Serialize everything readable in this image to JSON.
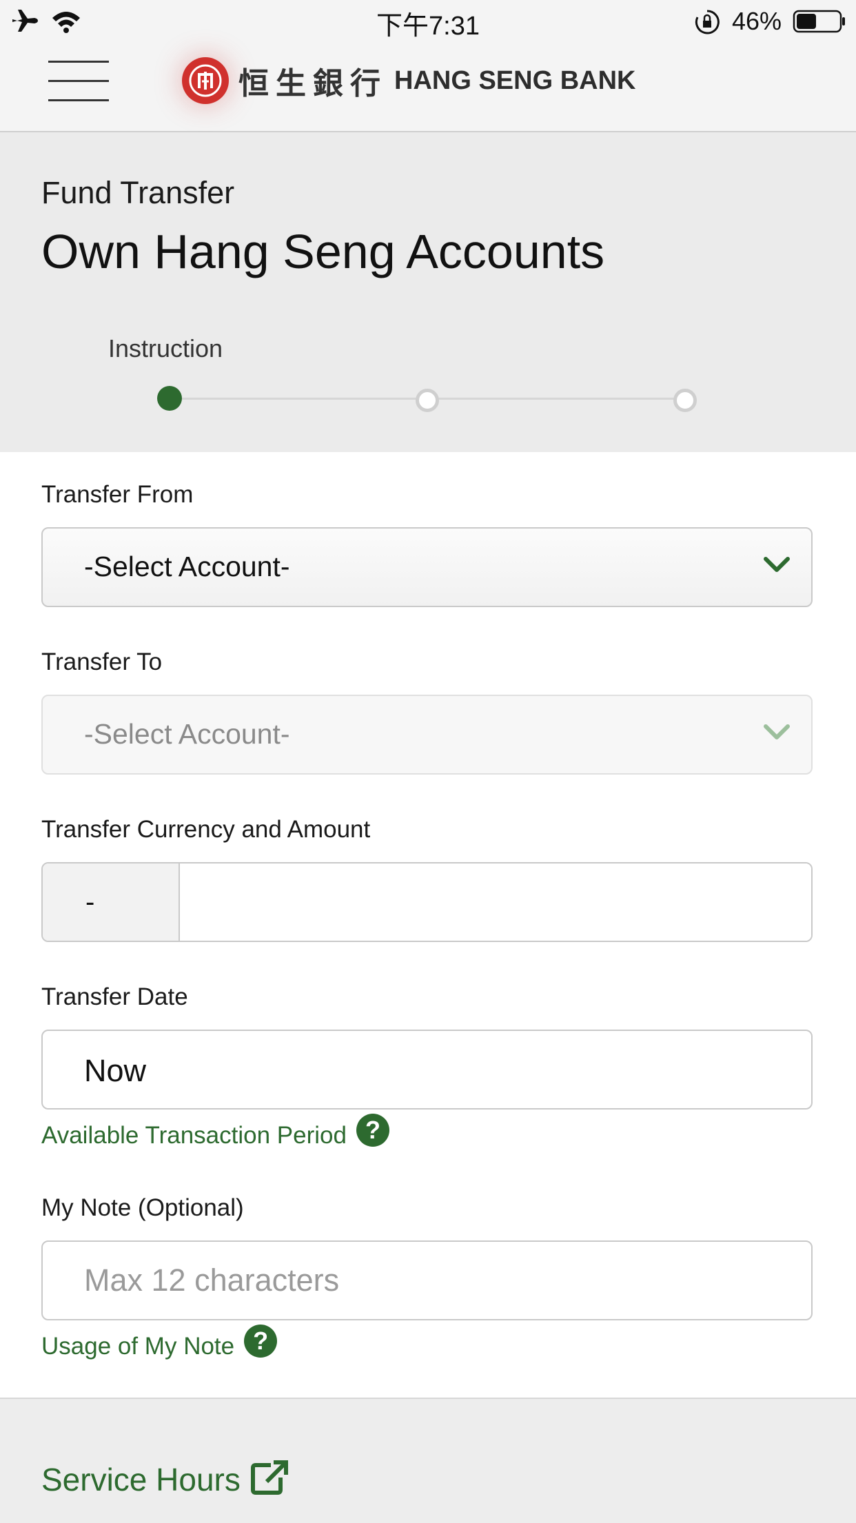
{
  "status_bar": {
    "time": "下午7:31",
    "battery_pct": "46%",
    "battery_level": 0.46
  },
  "header": {
    "brand_cn": "恒生銀行",
    "brand_en": "HANG SENG BANK"
  },
  "page": {
    "breadcrumb": "Fund Transfer",
    "title": "Own Hang Seng Accounts"
  },
  "stepper": {
    "current_label": "Instruction",
    "current_step": 1,
    "total_steps": 3
  },
  "form": {
    "transfer_from": {
      "label": "Transfer From",
      "value": "-Select Account-"
    },
    "transfer_to": {
      "label": "Transfer To",
      "value": "-Select Account-"
    },
    "currency_amount": {
      "label": "Transfer Currency and Amount",
      "currency": "-",
      "amount": ""
    },
    "transfer_date": {
      "label": "Transfer Date",
      "value": "Now",
      "help_link": "Available Transaction Period"
    },
    "note": {
      "label": "My Note (Optional)",
      "placeholder": "Max 12 characters",
      "help_link": "Usage of My Note"
    }
  },
  "footer": {
    "service_hours": "Service Hours"
  },
  "colors": {
    "accent_green": "#2d6a2f",
    "brand_red": "#d0312d"
  },
  "icons": [
    "airplane-icon",
    "wifi-icon",
    "rotation-lock-icon",
    "battery-icon",
    "menu-icon",
    "logo-seal-icon",
    "chevron-down-icon",
    "help-icon",
    "external-link-icon"
  ]
}
